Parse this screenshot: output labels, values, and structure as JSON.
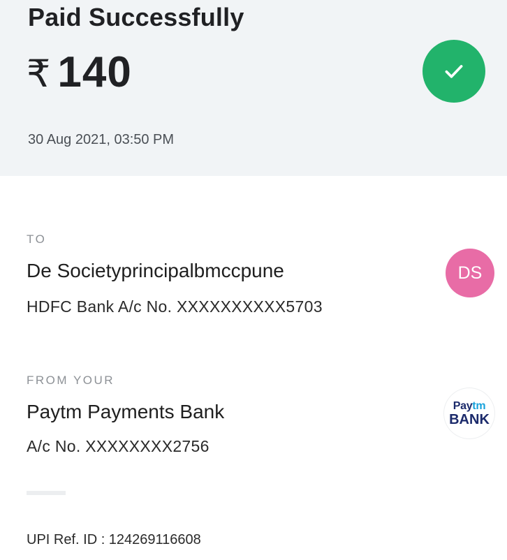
{
  "header": {
    "status_title": "Paid Successfully",
    "currency_symbol": "₹",
    "amount": "140",
    "timestamp": "30 Aug 2021, 03:50 PM",
    "success_icon": "check-icon",
    "background_color": "#f1f4f6",
    "success_color": "#22b36b"
  },
  "to": {
    "label": "TO",
    "name": "De Societyprincipalbmccpune",
    "account": "HDFC Bank A/c No. XXXXXXXXXX5703",
    "avatar_initials": "DS",
    "avatar_color": "#e86ca6"
  },
  "from": {
    "label": "FROM YOUR",
    "name": "Paytm Payments Bank",
    "account": "A/c No. XXXXXXXX2756",
    "logo_top_a": "Pay",
    "logo_top_b": "tm",
    "logo_bottom": "BANK"
  },
  "footer": {
    "upi_ref": "UPI Ref. ID : 124269116608"
  }
}
